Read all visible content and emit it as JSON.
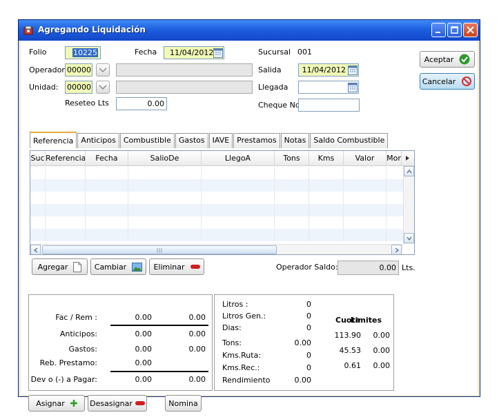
{
  "window": {
    "title": "Agregando Liquidación",
    "colors": {
      "title_bar": "#1f5fe0",
      "yellow_field": "#f0f9b6",
      "tab_accent": "#e8a93b"
    }
  },
  "form": {
    "folio_label": "Folio",
    "folio_value": "10225",
    "fecha_label": "Fecha",
    "fecha_value": "11/04/2012",
    "sucursal_label": "Sucursal",
    "sucursal_value": "001",
    "operador_label": "Operador",
    "operador_value": "00000",
    "operador_name": "",
    "salida_label": "Salida",
    "salida_value": "11/04/2012",
    "unidad_label": "Unidad:",
    "unidad_value": "00000",
    "unidad_name": "",
    "llegada_label": "Llegada",
    "llegada_value": "",
    "reseteo_label": "Reseteo Lts",
    "reseteo_value": "0.00",
    "cheque_label": "Cheque No",
    "cheque_value": ""
  },
  "actions": {
    "aceptar": "Aceptar",
    "cancelar": "Cancelar"
  },
  "tabs": [
    "Referencia",
    "Anticipos",
    "Combustible",
    "Gastos",
    "IAVE",
    "Prestamos",
    "Notas",
    "Saldo Combustible"
  ],
  "grid": {
    "columns": [
      "Suc",
      "Referencia",
      "Fecha",
      "SalioDe",
      "LlegoA",
      "Tons",
      "Kms",
      "Valor",
      "Mor"
    ],
    "rows": []
  },
  "grid_buttons": {
    "agregar": "Agregar",
    "cambiar": "Cambiar",
    "eliminar": "Eliminar"
  },
  "operador_saldo": {
    "label": "Operador Saldo:",
    "value": "0.00",
    "unit": "Lts."
  },
  "summary_left": [
    {
      "label": "Fac / Rem :",
      "v1": "0.00",
      "v2": "0.00"
    },
    {
      "label": "Anticipos:",
      "v1": "0.00",
      "v2": "0.00"
    },
    {
      "label": "Gastos:",
      "v1": "0.00",
      "v2": "0.00"
    },
    {
      "label": "Reb. Prestamo:",
      "v1": "0.00",
      "v2": ""
    },
    {
      "label": "Dev o (-) a Pagar:",
      "v1": "0.00",
      "v2": "0.00"
    }
  ],
  "summary_right": {
    "items": [
      {
        "label": "Litros :",
        "value": "0"
      },
      {
        "label": "Litros Gen.:",
        "value": "0"
      },
      {
        "label": "Dias:",
        "value": "0"
      },
      {
        "label": "Tons:",
        "value": "0.00"
      },
      {
        "label": "Kms.Ruta:",
        "value": "0"
      },
      {
        "label": "Kms.Rec.:",
        "value": "0"
      },
      {
        "label": "Rendimiento",
        "value": "0.00"
      }
    ],
    "cuota_header": "Cuota",
    "limites_header": "Limites",
    "cuota_rows": [
      {
        "cuota": "113.90",
        "limite": "0.00"
      },
      {
        "cuota": "45.53",
        "limite": "0.00"
      },
      {
        "cuota": "0.61",
        "limite": "0.00"
      }
    ]
  },
  "bottom_buttons": {
    "asignar": "Asignar",
    "desasignar": "Desasignar",
    "nomina": "Nomina"
  }
}
